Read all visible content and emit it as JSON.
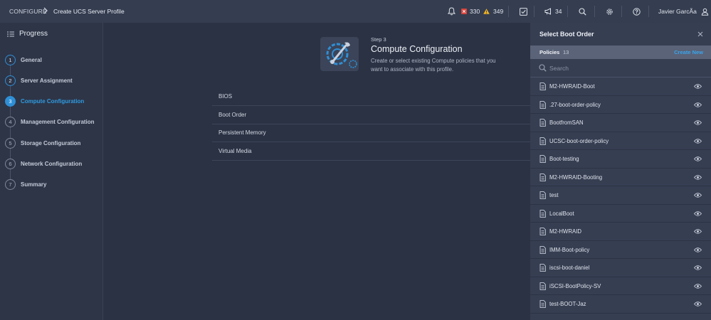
{
  "breadcrumb": {
    "root": "CONFIGURE",
    "page": "Create UCS Server Profile"
  },
  "topbar": {
    "critical_count": "330",
    "warning_count": "349",
    "announce_count": "34",
    "user_name": "Javier GarcÃa",
    "icons": [
      "bell-icon",
      "critical-alarm-icon",
      "warning-icon",
      "tasks-icon",
      "megaphone-icon",
      "search-icon",
      "gear-icon",
      "help-icon",
      "user-icon"
    ],
    "colors": {
      "critical": "#d9453c",
      "warning": "#f0b323"
    }
  },
  "progress": {
    "title": "Progress",
    "steps": [
      {
        "num": "1",
        "label": "General",
        "state": "done"
      },
      {
        "num": "2",
        "label": "Server Assignment",
        "state": "done"
      },
      {
        "num": "3",
        "label": "Compute Configuration",
        "state": "active"
      },
      {
        "num": "4",
        "label": "Management Configuration",
        "state": "todo"
      },
      {
        "num": "5",
        "label": "Storage Configuration",
        "state": "todo"
      },
      {
        "num": "6",
        "label": "Network Configuration",
        "state": "todo"
      },
      {
        "num": "7",
        "label": "Summary",
        "state": "todo"
      }
    ]
  },
  "main": {
    "step_label": "Step 3",
    "title": "Compute Configuration",
    "description": "Create or select existing Compute policies that you want to associate with this profile.",
    "policies": [
      "BIOS",
      "Boot Order",
      "Persistent Memory",
      "Virtual Media"
    ]
  },
  "drawer": {
    "title": "Select Boot Order",
    "policies_label": "Policies",
    "policies_count": "13",
    "create_new": "Create New",
    "search_placeholder": "Search",
    "items": [
      "M2-HWRAID-Boot",
      ".27-boot-order-policy",
      "BootfromSAN",
      "UCSC-boot-order-policy",
      "Boot-testing",
      "M2-HWRAID-Booting",
      "test",
      "LocalBoot",
      "M2-HWRAID",
      "IMM-Boot-policy",
      "iscsi-boot-daniel",
      "iSCSI-BootPolicy-SV",
      "test-BOOT-Jaz"
    ]
  },
  "accent_color": "#2f8fd6"
}
